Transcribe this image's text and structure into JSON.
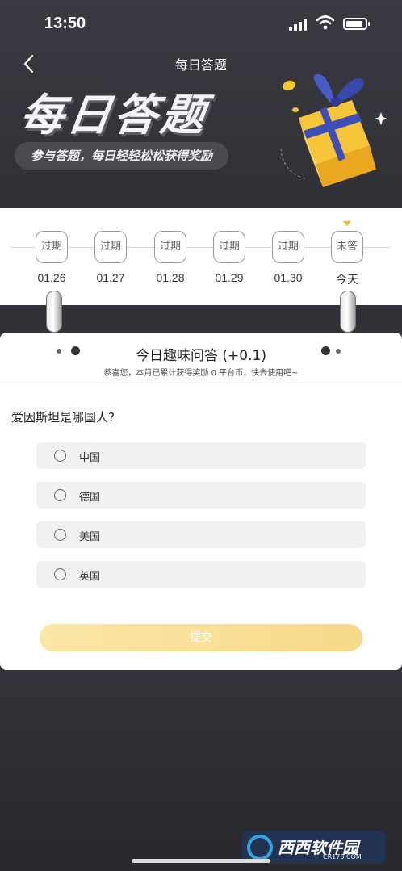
{
  "status_bar": {
    "time": "13:50"
  },
  "nav": {
    "title": "每日答题"
  },
  "banner": {
    "title": "每日答题",
    "subtitle": "参与答题，每日轻轻松松获得奖励"
  },
  "dates": [
    {
      "status": "过期",
      "date": "01.26"
    },
    {
      "status": "过期",
      "date": "01.27"
    },
    {
      "status": "过期",
      "date": "01.28"
    },
    {
      "status": "过期",
      "date": "01.29"
    },
    {
      "status": "过期",
      "date": "01.30"
    },
    {
      "status": "未答",
      "date": "今天"
    }
  ],
  "quiz": {
    "title": "今日趣味问答 (+0.1)",
    "subtitle": "恭喜您，本月已累计获得奖励 0 平台币，快去使用吧~",
    "question": "爱因斯坦是哪国人?",
    "options": [
      "中国",
      "德国",
      "美国",
      "英国"
    ],
    "submit_label": "提交"
  },
  "watermark": {
    "text": "西西软件园",
    "sub": "CR173.COM"
  },
  "colors": {
    "accent": "#f2b233",
    "submit": "#f8d98a",
    "background": "#2f2f36"
  }
}
